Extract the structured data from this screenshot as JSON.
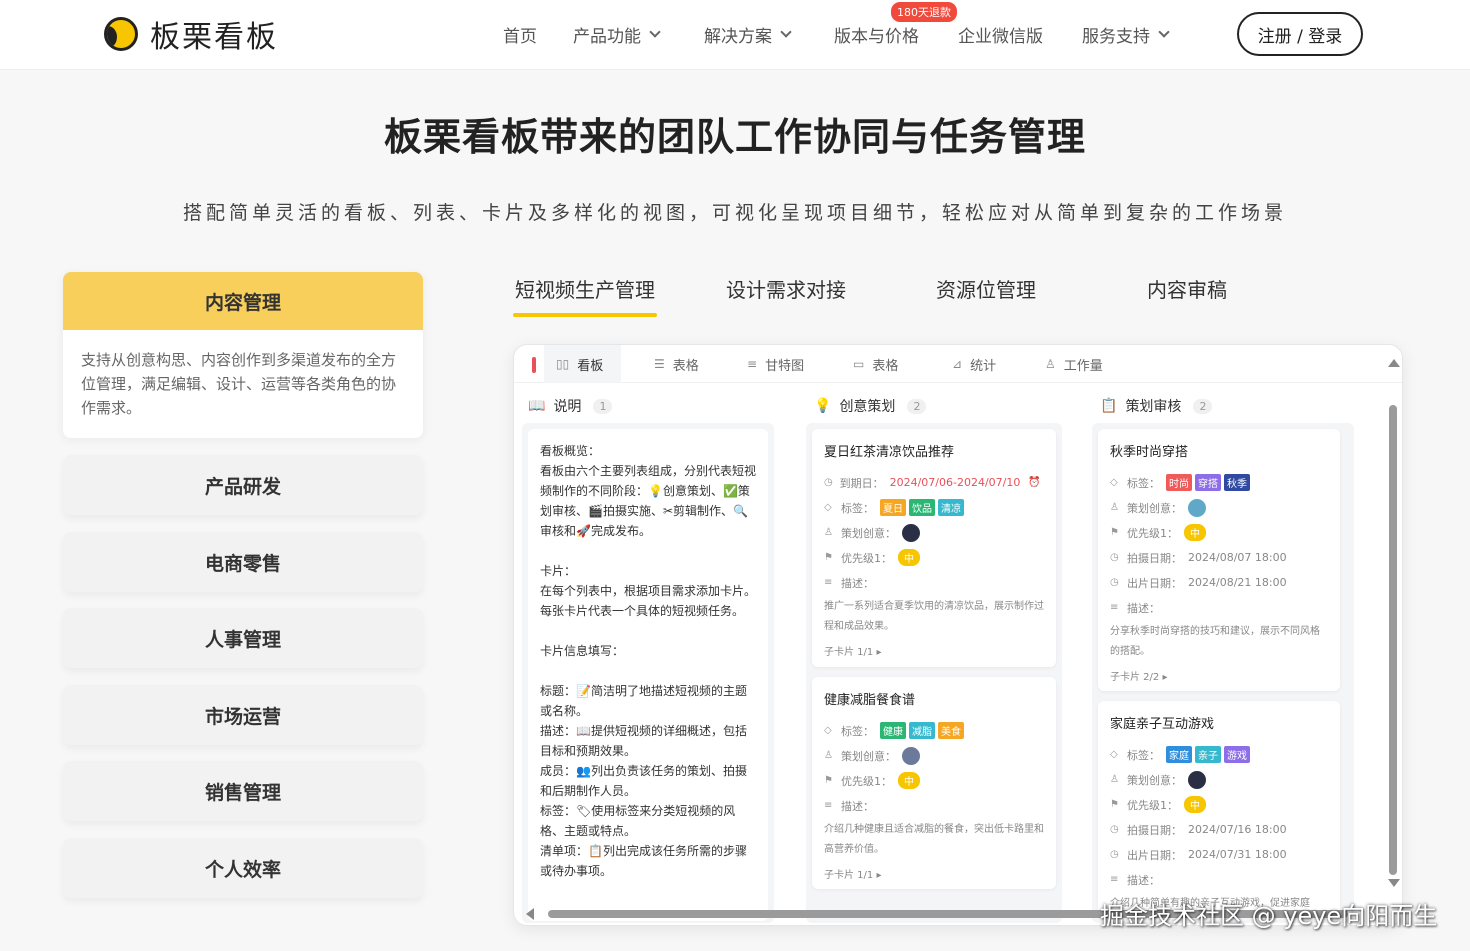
{
  "nav": {
    "logo_text": "板栗看板",
    "items": [
      "首页",
      "产品功能",
      "解决方案",
      "版本与价格",
      "企业微信版",
      "服务支持"
    ],
    "badge": "180天退款",
    "login": "注册 / 登录"
  },
  "hero": {
    "title": "板栗看板带来的团队工作协同与任务管理",
    "subtitle": "搭配简单灵活的看板、列表、卡片及多样化的视图，可视化呈现项目细节，轻松应对从简单到复杂的工作场景"
  },
  "side": {
    "active_title": "内容管理",
    "active_desc": "支持从创意构思、内容创作到多渠道发布的全方位管理，满足编辑、设计、运营等各类角色的协作需求。",
    "items": [
      "产品研发",
      "电商零售",
      "人事管理",
      "市场运营",
      "销售管理",
      "个人效率"
    ]
  },
  "tabs": [
    "短视频生产管理",
    "设计需求对接",
    "资源位管理",
    "内容审稿"
  ],
  "views": [
    "看板",
    "表格",
    "甘特图",
    "表格",
    "统计",
    "工作量"
  ],
  "columns": [
    {
      "name": "说明",
      "count": "1"
    },
    {
      "name": "创意策划",
      "count": "2"
    },
    {
      "name": "策划审核",
      "count": "2"
    }
  ],
  "desc_card": {
    "p1": [
      "看板概览：",
      "看板由六个主要列表组成，分别代表短视频制作的不同阶段：💡创意策划、✅策划审核、🎬拍摄实施、✂剪辑制作、🔍审核和🚀完成发布。"
    ],
    "p2": [
      "卡片：",
      "在每个列表中，根据项目需求添加卡片。每张卡片代表一个具体的短视频任务。"
    ],
    "p3": [
      "卡片信息填写：",
      "标题：📝简洁明了地描述短视频的主题或名称。",
      "描述：📖提供短视频的详细概述，包括目标和预期效果。",
      "成员：👥列出负责该任务的策划、拍摄和后期制作人员。",
      "标签：🏷使用标签来分类短视频的风格、主题或特点。",
      "清单项：📋列出完成该任务所需的步骤或待办事项。"
    ]
  },
  "labels": {
    "due": "到期日：",
    "tag": "标签：",
    "owner": "策划创意：",
    "priority": "优先级1：",
    "desc": "描述：",
    "shoot": "拍摄日期：",
    "release": "出片日期："
  },
  "cards": {
    "c1": {
      "title": "夏日红茶清凉饮品推荐",
      "date": "2024/07/06-2024/07/10",
      "tags": [
        "夏日",
        "饮品",
        "清凉"
      ],
      "priority": "中",
      "desc": "推广一系列适合夏季饮用的清凉饮品，展示制作过程和成品效果。",
      "sub": "子卡片 1/1 ▸"
    },
    "c2": {
      "title": "健康减脂餐食谱",
      "tags": [
        "健康",
        "减脂",
        "美食"
      ],
      "priority": "中",
      "desc": "介绍几种健康且适合减脂的餐食，突出低卡路里和高营养价值。",
      "sub": "子卡片 1/1 ▸"
    },
    "c3": {
      "title": "秋季时尚穿搭",
      "tags": [
        "时尚",
        "穿搭",
        "秋季"
      ],
      "priority": "中",
      "shoot": "2024/08/07 18:00",
      "release": "2024/08/21 18:00",
      "desc": "分享秋季时尚穿搭的技巧和建议，展示不同风格的搭配。",
      "sub": "子卡片 2/2 ▸"
    },
    "c4": {
      "title": "家庭亲子互动游戏",
      "tags": [
        "家庭",
        "亲子",
        "游戏"
      ],
      "priority": "中",
      "shoot": "2024/07/16 18:00",
      "release": "2024/07/31 18:00",
      "desc": "介绍几种简单有趣的亲子互动游戏，促进家庭"
    }
  },
  "colors": {
    "accent": "#f7c600",
    "menu_active": "#f8cf5a",
    "tag_orange": "#f5a623",
    "tag_green": "#2bb673",
    "tag_teal": "#36b9cf",
    "tag_red": "#ef5a5a",
    "tag_purple": "#8e6ee8",
    "tag_navy": "#2f4aa0",
    "tag_blue": "#2f8fdd"
  },
  "watermark": "掘金技术社区 @ yeye向阳而生"
}
